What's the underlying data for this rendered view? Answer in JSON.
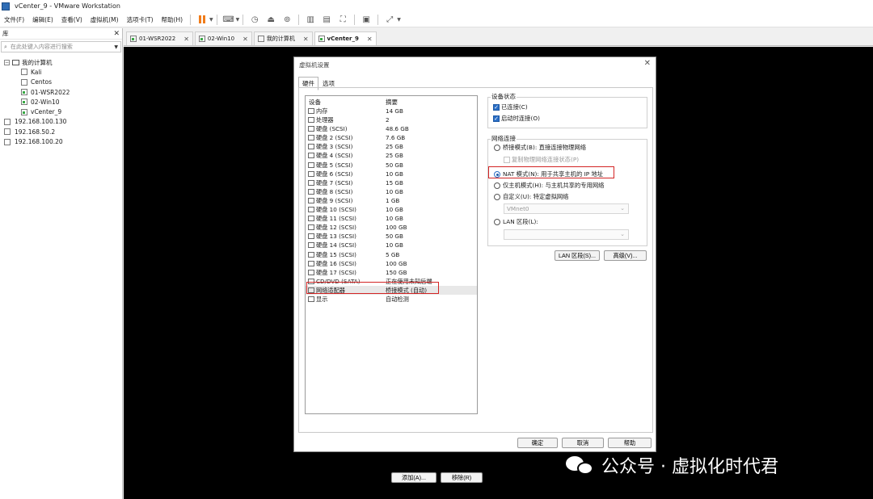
{
  "window": {
    "title": "vCenter_9 - VMware Workstation"
  },
  "menu": [
    {
      "label": "文件(F)"
    },
    {
      "label": "编辑(E)"
    },
    {
      "label": "查看(V)"
    },
    {
      "label": "虚拟机(M)"
    },
    {
      "label": "选项卡(T)"
    },
    {
      "label": "帮助(H)"
    }
  ],
  "library": {
    "header": "库",
    "search_placeholder": "在此处键入内容进行搜索",
    "tree": {
      "root": "我的计算机",
      "vms": [
        {
          "name": "Kali",
          "running": false
        },
        {
          "name": "Centos",
          "running": false
        },
        {
          "name": "01-WSR2022",
          "running": true
        },
        {
          "name": "02-Win10",
          "running": true
        },
        {
          "name": "vCenter_9",
          "running": true
        }
      ],
      "hosts": [
        "192.168.100.130",
        "192.168.50.2",
        "192.168.100.20"
      ]
    }
  },
  "tabs": [
    {
      "label": "01-WSR2022",
      "active": false
    },
    {
      "label": "02-Win10",
      "active": false
    },
    {
      "label": "我的计算机",
      "active": false
    },
    {
      "label": "vCenter_9",
      "active": true
    }
  ],
  "dialog": {
    "title": "虚拟机设置",
    "tabs": [
      "硬件",
      "选项"
    ],
    "device_list": {
      "col_device": "设备",
      "col_summary": "摘要",
      "rows": [
        {
          "name": "内存",
          "summary": "14 GB"
        },
        {
          "name": "处理器",
          "summary": "2"
        },
        {
          "name": "硬盘 (SCSI)",
          "summary": "48.6 GB"
        },
        {
          "name": "硬盘 2 (SCSI)",
          "summary": "7.6 GB"
        },
        {
          "name": "硬盘 3 (SCSI)",
          "summary": "25 GB"
        },
        {
          "name": "硬盘 4 (SCSI)",
          "summary": "25 GB"
        },
        {
          "name": "硬盘 5 (SCSI)",
          "summary": "50 GB"
        },
        {
          "name": "硬盘 6 (SCSI)",
          "summary": "10 GB"
        },
        {
          "name": "硬盘 7 (SCSI)",
          "summary": "15 GB"
        },
        {
          "name": "硬盘 8 (SCSI)",
          "summary": "10 GB"
        },
        {
          "name": "硬盘 9 (SCSI)",
          "summary": "1 GB"
        },
        {
          "name": "硬盘 10 (SCSI)",
          "summary": "10 GB"
        },
        {
          "name": "硬盘 11 (SCSI)",
          "summary": "10 GB"
        },
        {
          "name": "硬盘 12 (SCSI)",
          "summary": "100 GB"
        },
        {
          "name": "硬盘 13 (SCSI)",
          "summary": "50 GB"
        },
        {
          "name": "硬盘 14 (SCSI)",
          "summary": "10 GB"
        },
        {
          "name": "硬盘 15 (SCSI)",
          "summary": "5 GB"
        },
        {
          "name": "硬盘 16 (SCSI)",
          "summary": "100 GB"
        },
        {
          "name": "硬盘 17 (SCSI)",
          "summary": "150 GB"
        },
        {
          "name": "CD/DVD (SATA)",
          "summary": "正在使用未知后端"
        },
        {
          "name": "网络适配器",
          "summary": "桥接模式 (自动)",
          "selected": true
        },
        {
          "name": "显示",
          "summary": "自动检测"
        }
      ],
      "add_button": "添加(A)...",
      "remove_button": "移除(R)"
    },
    "device_status": {
      "label": "设备状态",
      "connected": "已连接(C)",
      "connect_at_power_on": "启动时连接(O)"
    },
    "network": {
      "label": "网络连接",
      "bridged": "桥接模式(B): 直接连接物理网络",
      "replicate": "复制物理网络连接状态(P)",
      "nat": "NAT 模式(N): 用于共享主机的 IP 地址",
      "host_only": "仅主机模式(H): 与主机共享的专用网络",
      "custom": "自定义(U): 特定虚拟网络",
      "custom_value": "VMnet0",
      "lan_segment": "LAN 区段(L):",
      "lan_segment_value": "",
      "lan_segments_button": "LAN 区段(S)...",
      "advanced_button": "高级(V)..."
    },
    "footer": {
      "ok": "确定",
      "cancel": "取消",
      "help": "帮助"
    }
  },
  "watermark": {
    "text": "公众号 · 虚拟化时代君"
  },
  "colors": {
    "accent": "#2a6ec6",
    "highlight": "#d32424",
    "console": "#000000"
  }
}
